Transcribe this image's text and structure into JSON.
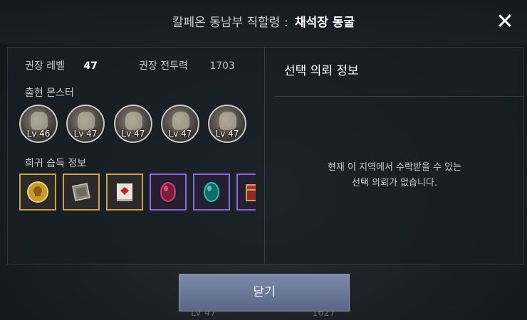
{
  "header": {
    "region": "칼페온 동남부 직할령",
    "separator": ":",
    "place": "채석장 동굴",
    "close_icon": "close-icon"
  },
  "stats": {
    "level_label": "권장 레벨",
    "level_value": "47",
    "power_label": "권장 전투력",
    "power_value": "1703"
  },
  "monsters": {
    "label": "출현 몬스터",
    "items": [
      {
        "level": "Lv 46",
        "icon": "monster-icon"
      },
      {
        "level": "Lv 47",
        "icon": "monster-icon"
      },
      {
        "level": "Lv 47",
        "icon": "monster-icon"
      },
      {
        "level": "Lv 47",
        "icon": "monster-icon"
      },
      {
        "level": "Lv 47",
        "icon": "monster-icon"
      }
    ]
  },
  "rare_drops": {
    "label": "희귀 습득 정보",
    "items": [
      {
        "icon": "gold-coin-skull-icon",
        "grade": "gold"
      },
      {
        "icon": "stone-tablet-icon",
        "grade": "gold"
      },
      {
        "icon": "scroll-icon",
        "grade": "gold"
      },
      {
        "icon": "red-gem-icon",
        "grade": "purple"
      },
      {
        "icon": "green-gem-icon",
        "grade": "purple"
      },
      {
        "icon": "treasure-chest-icon",
        "grade": "purple"
      }
    ]
  },
  "request": {
    "title": "선택 의뢰 정보",
    "message_line1": "현재 이 지역에서 수락받을 수 있는",
    "message_line2": "선택 의뢰가 없습니다."
  },
  "footer": {
    "close_label": "닫기"
  },
  "background": {
    "left_level": "LV 47",
    "right_value": "1627"
  }
}
